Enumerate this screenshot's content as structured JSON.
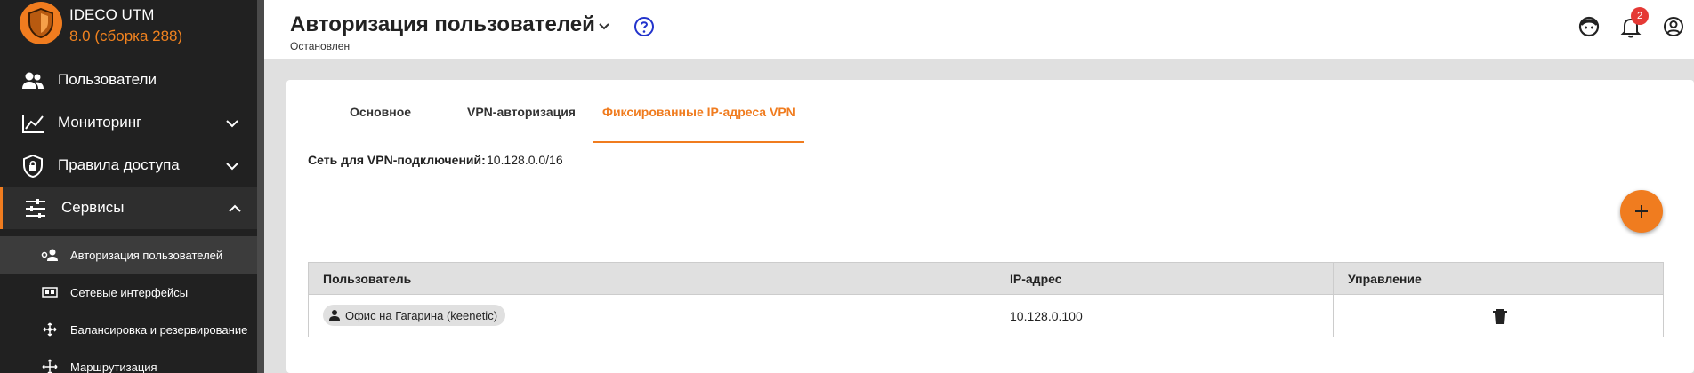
{
  "brand": {
    "name": "IDECO UTM",
    "version": "8.0 (сборка 288)"
  },
  "sidebar": {
    "items": [
      {
        "label": "Пользователи",
        "icon": "users-icon"
      },
      {
        "label": "Мониторинг",
        "icon": "monitoring-chart-icon"
      },
      {
        "label": "Правила доступа",
        "icon": "shield-lock-icon"
      },
      {
        "label": "Сервисы",
        "icon": "sliders-icon"
      }
    ],
    "subitems": [
      {
        "label": "Авторизация пользователей",
        "icon": "user-auth-icon"
      },
      {
        "label": "Сетевые интерфейсы",
        "icon": "network-interface-icon"
      },
      {
        "label": "Балансировка и резервирование",
        "icon": "balancing-icon"
      },
      {
        "label": "Маршрутизация",
        "icon": "routing-icon"
      }
    ]
  },
  "header": {
    "title": "Авторизация пользователей",
    "status": "Остановлен",
    "notification_count": "2"
  },
  "tabs": [
    {
      "label": "Основное"
    },
    {
      "label": "VPN-авторизация"
    },
    {
      "label": "Фиксированные IP-адреса VPN"
    }
  ],
  "vpn_network": {
    "label": "Сеть для VPN-подключений:",
    "value": "10.128.0.0/16"
  },
  "table": {
    "headers": [
      "Пользователь",
      "IP-адрес",
      "Управление"
    ],
    "rows": [
      {
        "user": "Офис на Гагарина (keenetic)",
        "ip": "10.128.0.100"
      }
    ]
  },
  "colors": {
    "accent": "#f07c1f",
    "sidebar_bg": "#212121",
    "badge": "#e53935"
  }
}
